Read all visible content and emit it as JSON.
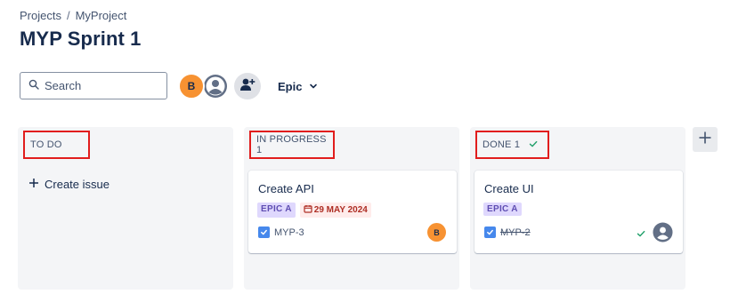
{
  "breadcrumb": {
    "items": [
      "Projects",
      "MyProject"
    ],
    "separator": "/"
  },
  "page_title": "MYP Sprint 1",
  "toolbar": {
    "search_placeholder": "Search",
    "avatar_initial": "B",
    "epic_filter_label": "Epic"
  },
  "columns": [
    {
      "title": "TO DO",
      "create_issue_label": "Create issue"
    },
    {
      "title": "IN PROGRESS 1"
    },
    {
      "title": "DONE 1"
    }
  ],
  "cards": [
    {
      "title": "Create API",
      "epic": "EPIC A",
      "due_date": "29 MAY 2024",
      "key": "MYP-3",
      "assignee_initial": "B",
      "done": false
    },
    {
      "title": "Create UI",
      "epic": "EPIC A",
      "key": "MYP-2",
      "done": true
    }
  ],
  "colors": {
    "accent": "#4688ec",
    "avatar_orange": "#f79232",
    "epic_bg": "#dfd8fd",
    "epic_text": "#5e4db2",
    "date_bg": "#ffeceb",
    "date_text": "#ae2e24",
    "highlight_border": "#e11d1d",
    "done_check": "#22a06b"
  },
  "icons": [
    "search-icon",
    "user-avatar-icon",
    "add-people-icon",
    "chevron-down-icon",
    "plus-icon",
    "calendar-icon",
    "checkbox-icon",
    "check-icon"
  ]
}
